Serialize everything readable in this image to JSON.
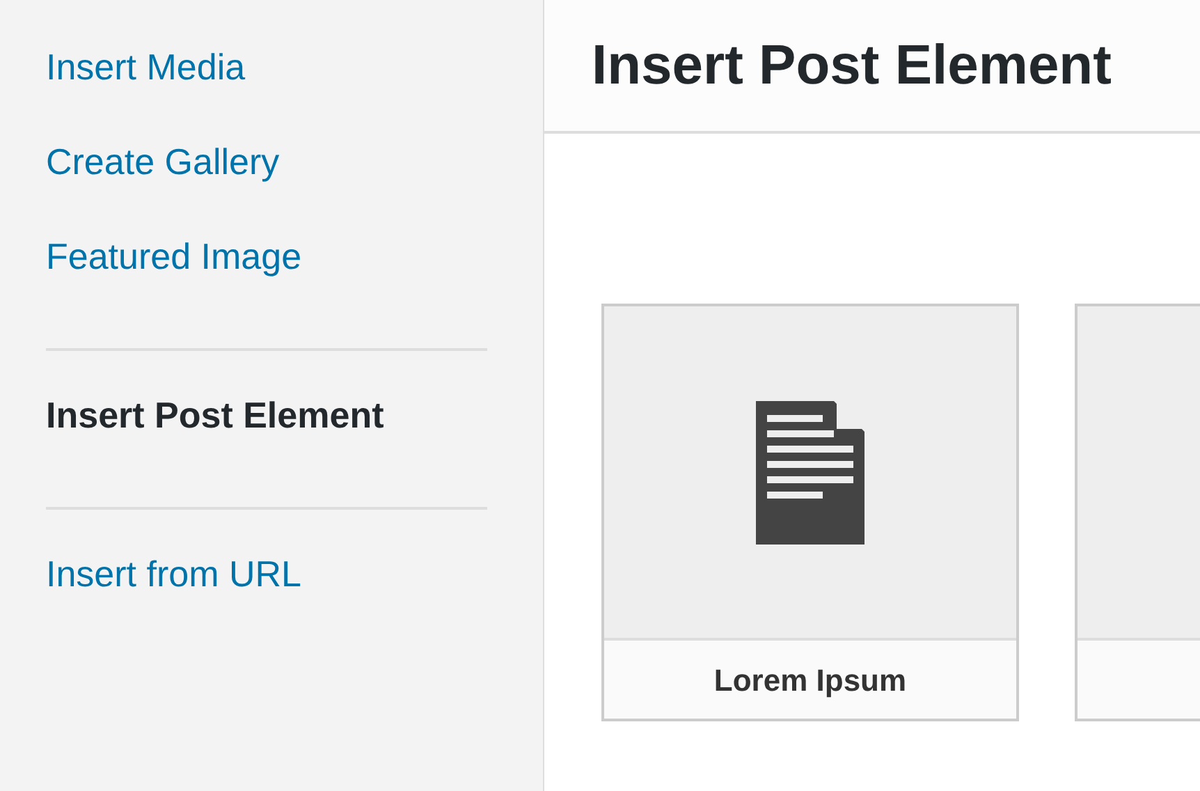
{
  "sidebar": {
    "sections": [
      {
        "items": [
          {
            "label": "Insert Media",
            "selected": false
          },
          {
            "label": "Create Gallery",
            "selected": false
          },
          {
            "label": "Featured Image",
            "selected": false
          }
        ]
      },
      {
        "items": [
          {
            "label": "Insert Post Element",
            "selected": true
          }
        ]
      },
      {
        "items": [
          {
            "label": "Insert from URL",
            "selected": false
          }
        ]
      }
    ]
  },
  "header": {
    "title": "Insert Post Element"
  },
  "cards": [
    {
      "kind": "document",
      "title": "Lorem Ipsum"
    },
    {
      "kind": "blank"
    }
  ]
}
